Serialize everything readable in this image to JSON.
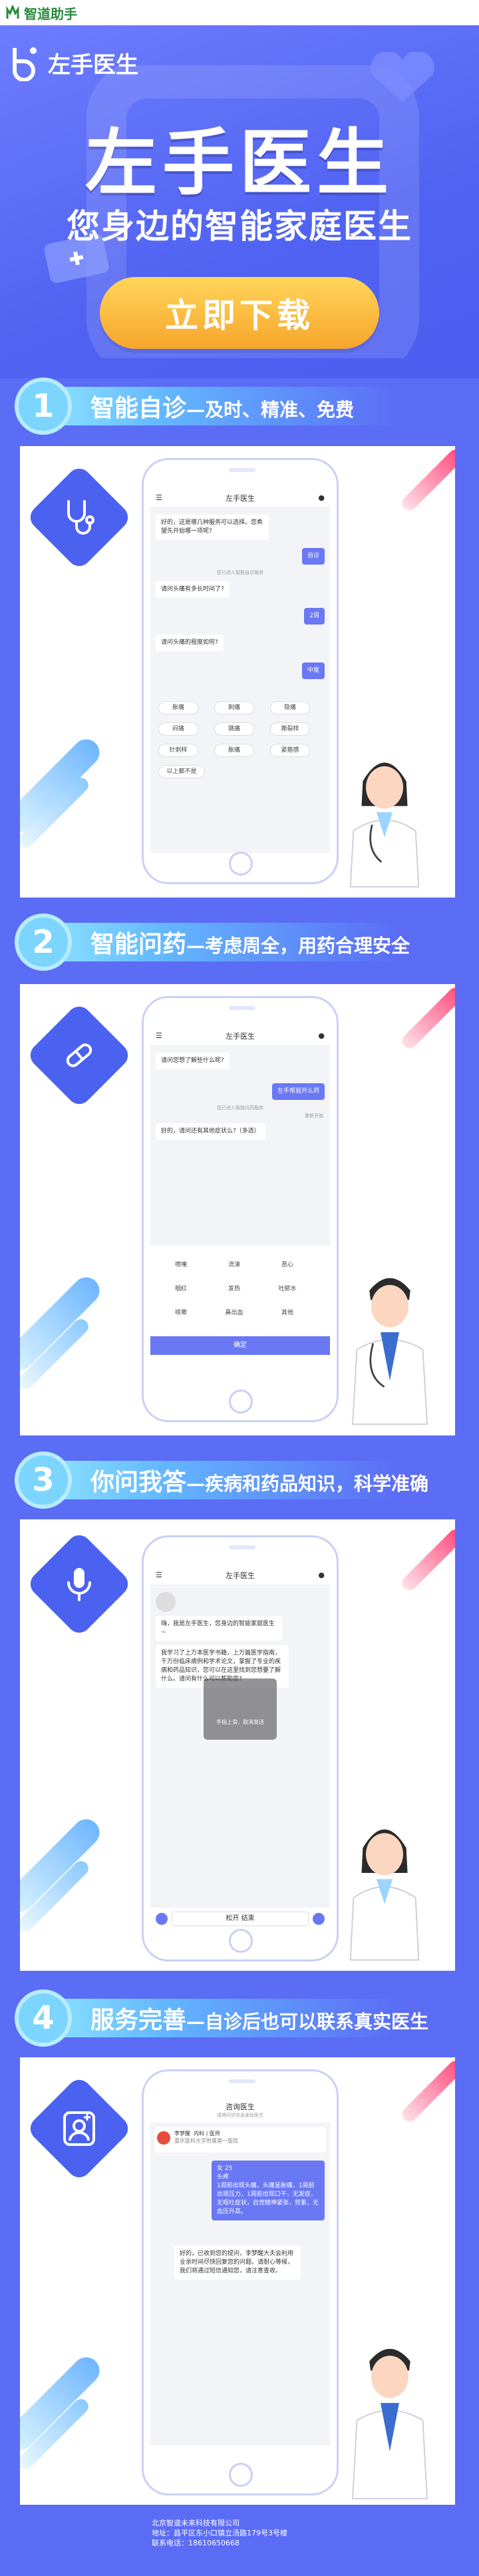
{
  "topbar": {
    "app_name": "智道助手"
  },
  "hero": {
    "brand": "左手医生",
    "title": "左手医生",
    "subtitle": "您身边的智能家庭医生",
    "download_label": "立即下载"
  },
  "sections": [
    {
      "num": "1",
      "title": "智能自诊",
      "subtitle": "—及时、精准、免费"
    },
    {
      "num": "2",
      "title": "智能问药",
      "subtitle": "—考虑周全，用药合理安全"
    },
    {
      "num": "3",
      "title": "你问我答",
      "subtitle": "—疾病和药品知识，科学准确"
    },
    {
      "num": "4",
      "title": "服务完善",
      "subtitle": "—自诊后也可以联系真实医生"
    }
  ],
  "phone1": {
    "header": "左手医生",
    "msg1": "好的，这是哪几种服务可以选择。您希望先开始哪一项呢?",
    "user1": "自诊",
    "sys1": "您已进入智能自诊服务",
    "msg2": "请问头痛有多长时间了?",
    "user2": "2周",
    "msg3": "请问头痛的程度如何?",
    "user3": "中度",
    "options": [
      "胀痛",
      "刺痛",
      "隐痛",
      "闷痛",
      "跳痛",
      "撕裂样",
      "针刺样",
      "胀痛",
      "搏动样",
      "紧箍感"
    ],
    "option_last": "以上都不是"
  },
  "phone2": {
    "header": "左手医生",
    "msg1": "请问您想了解些什么呢?",
    "user1": "左手帮我开么药",
    "sys1": "您已进入智能问药服务",
    "note": "重新开始",
    "msg2": "好的，请问还有其他症状么?（多选）",
    "options": [
      "喷嚏",
      "流涕",
      "恶心",
      "咽红",
      "发热",
      "吐脓水",
      "咳嗽",
      "鼻出血",
      "其他"
    ],
    "confirm": "确定"
  },
  "phone3": {
    "header": "左手医生",
    "msg1": "嗨，我是左手医生，您身边的智能家庭医生~",
    "msg2": "我学习了上万本医学书籍，上万篇医学指南，千万份临床病例和学术论文，掌握了专业的疾病和药品知识，您可以在这里找到您想要了解什么。请问有什么可以帮助您?",
    "overlay": "手指上滑，取消发送",
    "talk_btn": "松开 结束"
  },
  "phone4": {
    "header": "咨询医生",
    "sub": "请将问诊信息发给医生",
    "doctor_name": "李梦醒",
    "doctor_title": "内科 | 医师",
    "hospital": "重庆医科大学附属第一医院",
    "case": "女 25\n头疼\n1周前出现头痛，头痛呈胀痛，1周前出现压力，1周前出现口干，无发症，无呕吐症状，自觉精神紧张，劳累，无血压升高。",
    "doctor_reply": "好的，已收到您的提问，李梦醒大夫会利用业余时间尽快回复您的问题。请耐心等候，我们将通过短信通知您，请注意查收。"
  },
  "footer": {
    "line1": "北京智道未来科技有限公司",
    "line2": "地址：昌平区东小口镇立汤路179号3号楼",
    "line3": "联系电话：18610650668"
  },
  "colors": {
    "bg": "#5b6cf5",
    "accent": "#ffc347",
    "bubble": "#6a78f3",
    "diamond": "#4b62f0"
  }
}
